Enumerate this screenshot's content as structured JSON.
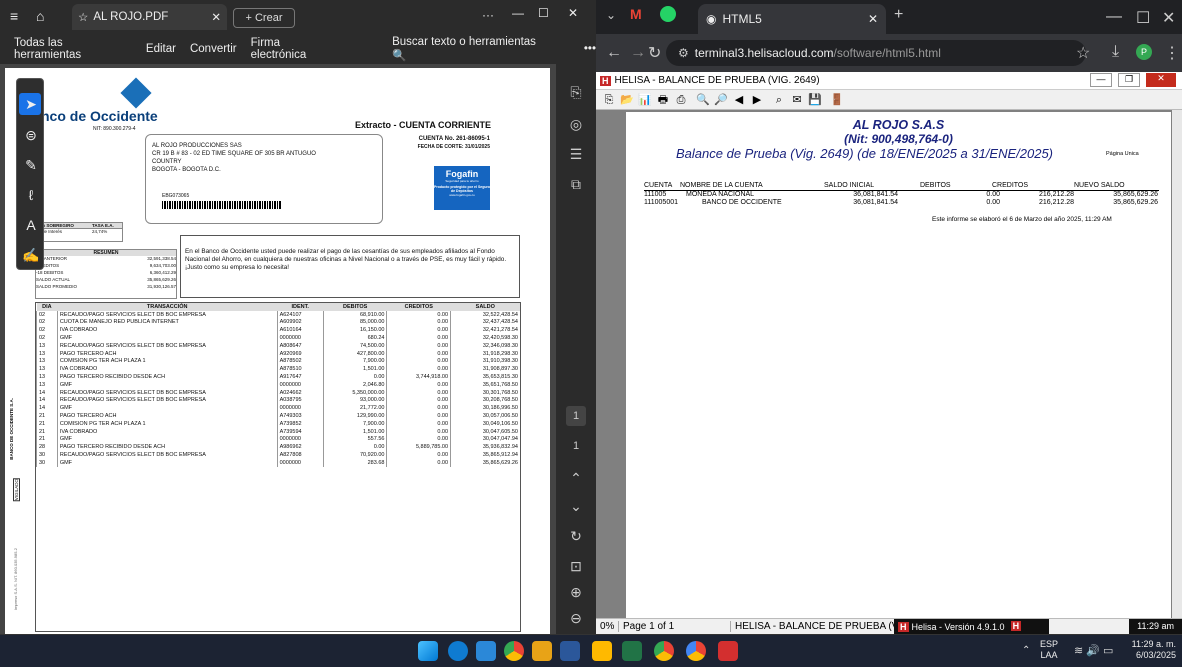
{
  "left_window": {
    "tab_title": "AL ROJO.PDF",
    "new_tab_label": "+ Crear",
    "menu": [
      "Todas las herramientas",
      "Editar",
      "Convertir",
      "Firma electrónica"
    ],
    "search_placeholder": "Buscar texto o herramientas",
    "page_number": "1",
    "page_total": "1"
  },
  "pdf": {
    "bank_name": "nco de Occidente",
    "bank_nit": "NIT: 890.300.279-4",
    "statement_title": "Extracto - CUENTA CORRIENTE",
    "account_no": "CUENTA No. 261-86095-1",
    "cut_date": "FECHA DE CORTE: 31/01/2025",
    "client_name": "AL ROJO PRODUCCIONES SAS",
    "client_addr1": "CR 19 B # 83 - 02 ED TIME SQUARE OF 305 BR ANTUGUO",
    "client_addr2": "COUNTRY",
    "client_city": "BOGOTA - BOGOTA D.C.",
    "barcode_code": "EBG073065",
    "fogafin": "Fogafin",
    "fogafin_sub1": "Seguridad para tu ahorro",
    "fogafin_sub2": "Producto protegido por el Seguro de Depósitos",
    "fogafin_url": "www.fogafin.gov.co",
    "overdraft_h1": "A SOBREGIRO",
    "overdraft_h2": "TASA E.A.",
    "overdraft_l": "de Interés",
    "overdraft_v": "24,74%",
    "summary_title": "RESUMEN",
    "summary": [
      [
        "DO ANTERIOR",
        "32,591,338.54"
      ],
      [
        "CREDITOS",
        "9,634,703.00"
      ],
      [
        "-18 DEBITOS",
        "6,360,412.29"
      ],
      [
        "SALDO ACTUAL",
        "35,865,629.26"
      ],
      [
        "SALDO PROMEDIO",
        "31,930,126.57"
      ]
    ],
    "message": "En el Banco de Occidente usted puede realizar el pago de las cesantías de sus empleados afiliados al Fondo Nacional del Ahorro, en cualquiera de nuestras oficinas a Nivel Nacional o a través de PSE, es muy fácil y rápido. ¡Justo como su empresa lo necesita!",
    "columns": [
      "DIA",
      "TRANSACCIÓN",
      "IDENT.",
      "DEBITOS",
      "CREDITOS",
      "SALDO"
    ],
    "rows": [
      [
        "02",
        "RECAUDO/PAGO SERVICIOS ELECT DB BOC EMPRESA",
        "A624107",
        "68,910.00",
        "0.00",
        "32,522,428.54"
      ],
      [
        "02",
        "CUOTA DE MANEJO RED PUBLICA INTERNET",
        "A609902",
        "85,000.00",
        "0.00",
        "32,437,428.54"
      ],
      [
        "02",
        "IVA COBRADO",
        "A610164",
        "16,150.00",
        "0.00",
        "32,421,278.54"
      ],
      [
        "02",
        "GMF",
        "0000000",
        "680.24",
        "0.00",
        "32,420,598.30"
      ],
      [
        "13",
        "RECAUDO/PAGO SERVICIOS ELECT DB BOC EMPRESA",
        "A808647",
        "74,500.00",
        "0.00",
        "32,346,098.30"
      ],
      [
        "13",
        "PAGO TERCERO ACH",
        "A920969",
        "427,800.00",
        "0.00",
        "31,918,298.30"
      ],
      [
        "13",
        "COMISION PG TER ACH PLAZA 1",
        "A878502",
        "7,900.00",
        "0.00",
        "31,910,398.30"
      ],
      [
        "13",
        "IVA COBRADO",
        "A878510",
        "1,501.00",
        "0.00",
        "31,908,897.30"
      ],
      [
        "13",
        "PAGO TERCERO RECIBIDO DESDE ACH",
        "A917647",
        "0.00",
        "3,744,918.00",
        "35,653,815.30"
      ],
      [
        "13",
        "GMF",
        "0000000",
        "2,046.80",
        "0.00",
        "35,651,768.50"
      ],
      [
        "14",
        "RECAUDO/PAGO SERVICIOS ELECT DB BOC EMPRESA",
        "A024662",
        "5,350,000.00",
        "0.00",
        "30,301,768.50"
      ],
      [
        "14",
        "RECAUDO/PAGO SERVICIOS ELECT DB BOC EMPRESA",
        "A038795",
        "93,000.00",
        "0.00",
        "30,208,768.50"
      ],
      [
        "14",
        "GMF",
        "0000000",
        "21,772.00",
        "0.00",
        "30,186,996.50"
      ],
      [
        "21",
        "PAGO TERCERO ACH",
        "A749303",
        "129,990.00",
        "0.00",
        "30,057,006.50"
      ],
      [
        "21",
        "COMISION PG TER ACH PLAZA 1",
        "A739852",
        "7,900.00",
        "0.00",
        "30,049,106.50"
      ],
      [
        "21",
        "IVA COBRADO",
        "A739594",
        "1,501.00",
        "0.00",
        "30,047,605.50"
      ],
      [
        "21",
        "GMF",
        "0000000",
        "557.56",
        "0.00",
        "30,047,047.94"
      ],
      [
        "28",
        "PAGO TERCERO RECIBIDO DESDE ACH",
        "A986962",
        "0.00",
        "5,889,785.00",
        "35,936,832.94"
      ],
      [
        "30",
        "RECAUDO/PAGO SERVICIOS ELECT DB BOC EMPRESA",
        "A827808",
        "70,920.00",
        "0.00",
        "35,865,912.94"
      ],
      [
        "30",
        "GMF",
        "0000000",
        "283.68",
        "0.00",
        "35,865,629.26"
      ]
    ],
    "side_text": "BANCO DE OCCIDENTE S.A.",
    "vigilado": "VIGILADO",
    "bottom_side": "Impreso S.A.S. NIT. 860.035.985-2"
  },
  "right_window": {
    "tab_title": "HTML5",
    "url_domain": "terminal3.helisacloud.com",
    "url_path": "/software/html5.html",
    "profile_letter": "P"
  },
  "helisa": {
    "title": "HELISA - BALANCE DE PRUEBA (VIG. 2649)",
    "company": "AL ROJO S.A.S",
    "nit": "(Nit: 900,498,764-0)",
    "report_title": "Balance de Prueba (Vig. 2649) (de 18/ENE/2025 a 31/ENE/2025)",
    "page_label": "Página Unica",
    "columns": [
      "CUENTA",
      "NOMBRE DE LA CUENTA",
      "SALDO INICIAL",
      "DEBITOS",
      "CREDITOS",
      "NUEVO SALDO"
    ],
    "rows": [
      [
        "111005",
        "MONEDA NACIONAL",
        "36,081,841.54",
        "0.00",
        "216,212.28",
        "35,865,629.26"
      ],
      [
        "111005001",
        "BANCO DE OCCIDENTE",
        "36,081,841.54",
        "0.00",
        "216,212.28",
        "35,865,629.26"
      ]
    ],
    "footer_note": "Este informe se elaboró el 6 de Marzo del año 2025, 11:29 AM",
    "status_zoom": "0%",
    "status_page": "Page 1 of 1",
    "status_title": "HELISA - BALANCE DE PRUEBA (VIG. 2649)",
    "version": "Helisa - Versión 4.9.1.0",
    "status_time": "11:29 am"
  },
  "taskbar": {
    "lang1": "ESP",
    "lang2": "LAA",
    "time": "11:29 a. m.",
    "date": "6/03/2025"
  }
}
